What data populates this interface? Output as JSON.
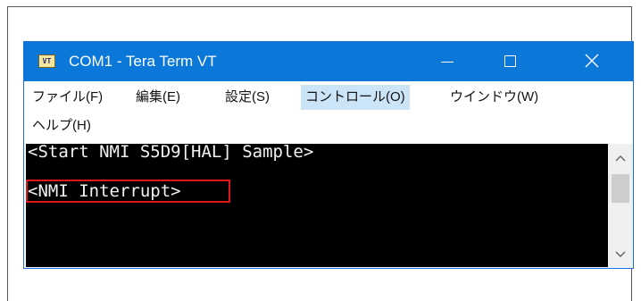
{
  "window": {
    "title": "COM1 - Tera Term VT",
    "icon_label": "VT",
    "icon_name": "teraterm-app-icon"
  },
  "title_controls": {
    "minimize_icon": "minimize-icon",
    "maximize_icon": "maximize-icon",
    "close_icon": "close-icon"
  },
  "menu": {
    "items": [
      {
        "label": "ファイル(F)"
      },
      {
        "label": "編集(E)"
      },
      {
        "label": "設定(S)"
      },
      {
        "label": "コントロール(O)",
        "active": true
      },
      {
        "label": "ウインドウ(W)"
      },
      {
        "label": "ヘルプ(H)"
      }
    ]
  },
  "terminal": {
    "lines": [
      "<Start NMI S5D9[HAL] Sample>",
      "<NMI Interrupt>"
    ],
    "highlight_color": "#e0161b"
  },
  "colors": {
    "titlebar": "#0a77d9",
    "terminal_bg": "#000000",
    "terminal_fg": "#f2f2f2",
    "menu_active": "#cce4f7"
  }
}
